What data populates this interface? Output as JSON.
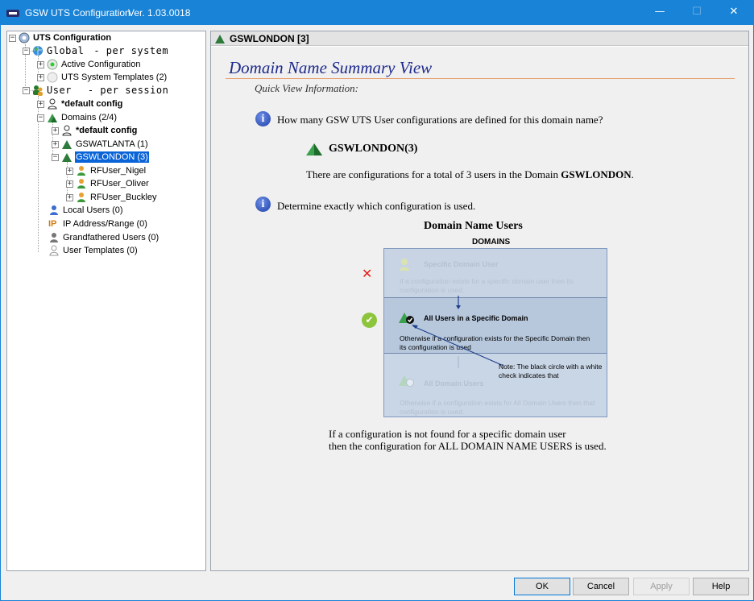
{
  "window": {
    "title": "GSW UTS Configuration",
    "version": "Ver. 1.03.0018",
    "controls": {
      "minimize": "—",
      "maximize": "☐",
      "close": "✕"
    }
  },
  "tree": {
    "root": "UTS Configuration",
    "global": {
      "label": "Global",
      "suffix": "- per system"
    },
    "active_config": "Active Configuration",
    "system_templates": "UTS System Templates (2)",
    "user": {
      "label": "User",
      "suffix": "- per session"
    },
    "default_config": "*default config",
    "domains": "Domains (2/4)",
    "domain_default_config": "*default config",
    "gswatlanta": "GSWATLANTA (1)",
    "gswlondon": "GSWLONDON (3)",
    "users": [
      "RFUser_Nigel",
      "RFUser_Oliver",
      "RFUser_Buckley"
    ],
    "local_users": "Local Users (0)",
    "ip_range": "IP Address/Range (0)",
    "ip_icon_text": "IP",
    "grandfathered": "Grandfathered Users (0)",
    "user_templates": "User Templates (0)",
    "expand_plus": "+",
    "expand_minus": "−"
  },
  "content": {
    "header": "GSWLONDON [3]",
    "title": "Domain Name Summary View",
    "quick_view": "Quick View Information:",
    "info_glyph": "i",
    "q1": "How many GSW UTS User configurations are defined for this domain name?",
    "domain_name": "GSWLONDON(3)",
    "total_prefix": "There are configurations for a total of 3 users in the Domain ",
    "total_domain": "GSWLONDON",
    "total_suffix": ".",
    "q2": "Determine exactly which configuration is used.",
    "diagram": {
      "title": "Domain Name Users",
      "subtitle": "DOMAINS",
      "sec1_title": "Specific Domain User",
      "sec1_text": "If a configuration exists for a specific domain user then its configuration is used.",
      "sec2_title": "All Users in a Specific Domain",
      "sec2_text": "Otherwise if a configuration exists for the Specific Domain then its configuration is used",
      "note": "Note: The black circle with a white check indicates that",
      "sec3_title": "All Domain Users",
      "sec3_text": "Otherwise if a configuration exists for All Domain Users then that configuration is used.",
      "x_mark": "✕",
      "check_mark": "✔"
    },
    "footer_line1": "If a configuration is not found for a specific domain user",
    "footer_line2": "then the configuration for ALL DOMAIN NAME USERS is used."
  },
  "buttons": {
    "ok": "OK",
    "cancel": "Cancel",
    "apply": "Apply",
    "help": "Help"
  },
  "colors": {
    "titlebar": "#1883d7",
    "selection": "#0a64d8",
    "heading": "#1e2a8c",
    "rule": "#e8a070"
  }
}
